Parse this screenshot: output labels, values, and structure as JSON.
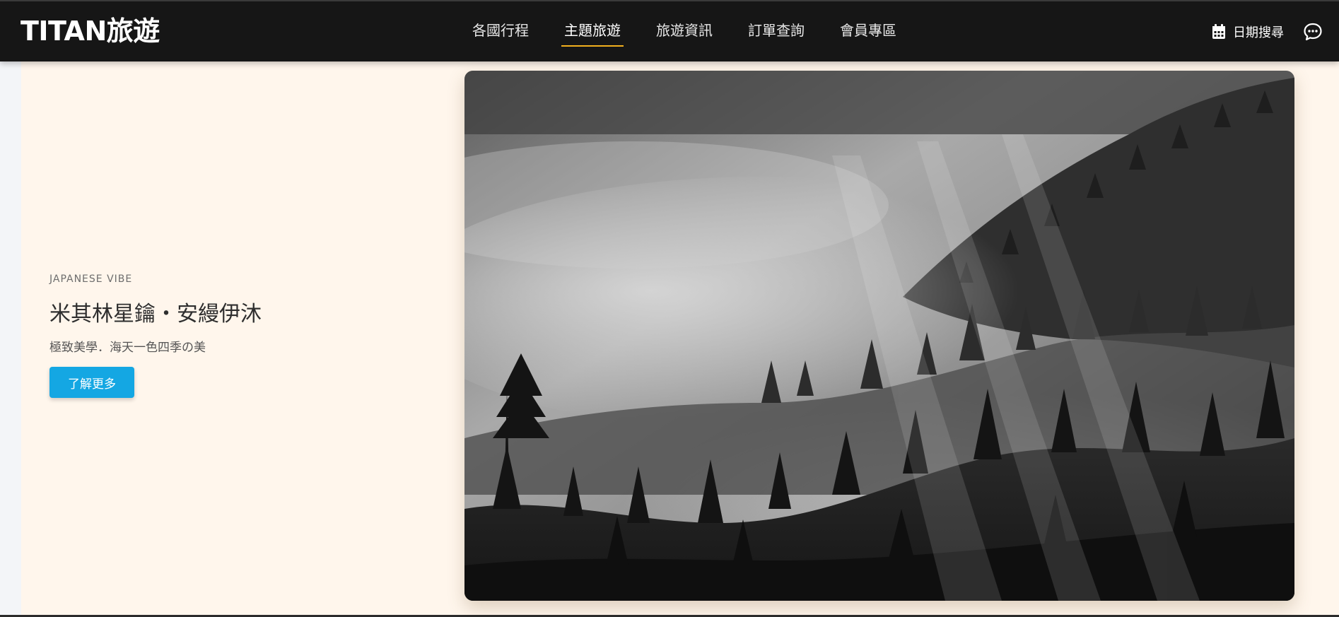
{
  "header": {
    "brand": "TITAN旅遊",
    "nav": [
      {
        "label": "各國行程",
        "active": false
      },
      {
        "label": "主題旅遊",
        "active": true
      },
      {
        "label": "旅遊資訊",
        "active": false
      },
      {
        "label": "訂單查詢",
        "active": false
      },
      {
        "label": "會員專區",
        "active": false
      }
    ],
    "date_search_label": "日期搜尋",
    "date_search_icon": "calendar-icon",
    "chat_icon": "chat-bubble-icon",
    "accent_color": "#f2b01e"
  },
  "hero": {
    "eyebrow": "JAPANESE VIBE",
    "title": "米其林星鑰・安縵伊沐",
    "subtitle": "極致美學．海天一色四季の美",
    "cta_label": "了解更多",
    "cta_color": "#14a7e3",
    "background_color": "#fff6ec"
  }
}
